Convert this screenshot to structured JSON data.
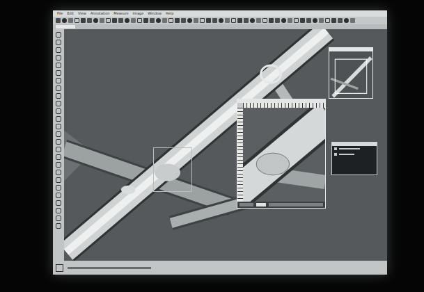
{
  "menu": [
    "File",
    "Edit",
    "View",
    "Annotation",
    "Measure",
    "Image",
    "Window",
    "Help"
  ]
}
